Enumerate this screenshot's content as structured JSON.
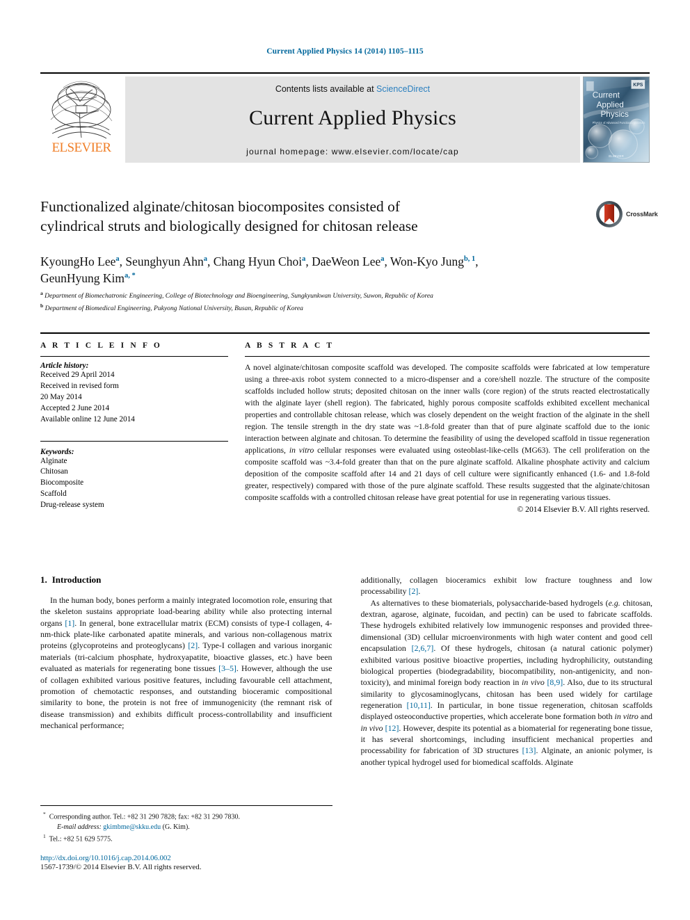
{
  "running_head": "Current Applied Physics 14 (2014) 1105–1115",
  "masthead": {
    "publisher": "ELSEVIER",
    "contents_prefix": "Contents lists available at ",
    "contents_link": "ScienceDirect",
    "journal_title": "Current Applied Physics",
    "homepage": "journal homepage: www.elsevier.com/locate/cap",
    "cover_line1": "Current",
    "cover_line2": "Applied",
    "cover_line3": "Physics",
    "cover_sub": "Physics of Advanced Functional Materials & Devices",
    "cover_badge": "KPS"
  },
  "title": {
    "line1": "Functionalized alginate/chitosan biocomposites consisted of",
    "line2": "cylindrical struts and biologically designed for chitosan release",
    "crossmark_label": "CrossMark"
  },
  "authors": {
    "list": [
      {
        "name": "KyoungHo Lee",
        "sup": "a"
      },
      {
        "name": "Seunghyun Ahn",
        "sup": "a"
      },
      {
        "name": "Chang Hyun Choi",
        "sup": "a"
      },
      {
        "name": "DaeWeon Lee",
        "sup": "a"
      },
      {
        "name": "Won-Kyo Jung",
        "sup": "b, 1"
      },
      {
        "name": "GeunHyung Kim",
        "sup": "a, *"
      }
    ],
    "affiliations": [
      {
        "marker": "a",
        "text": "Department of Biomechatronic Engineering, College of Biotechnology and Bioengineering, Sungkyunkwan University, Suwon, Republic of Korea"
      },
      {
        "marker": "b",
        "text": "Department of Biomedical Engineering, Pukyong National University, Busan, Republic of Korea"
      }
    ]
  },
  "article_info": {
    "heading": "A R T I C L E  I N F O",
    "history_label": "Article history:",
    "history": [
      "Received 29 April 2014",
      "Received in revised form",
      "20 May 2014",
      "Accepted 2 June 2014",
      "Available online 12 June 2014"
    ],
    "keywords_label": "Keywords:",
    "keywords": [
      "Alginate",
      "Chitosan",
      "Biocomposite",
      "Scaffold",
      "Drug-release system"
    ]
  },
  "abstract": {
    "heading": "A B S T R A C T",
    "text_part1": "A novel alginate/chitosan composite scaffold was developed. The composite scaffolds were fabricated at low temperature using a three-axis robot system connected to a micro-dispenser and a core/shell nozzle. The structure of the composite scaffolds included hollow struts; deposited chitosan on the inner walls (core region) of the struts reacted electrostatically with the alginate layer (shell region). The fabricated, highly porous composite scaffolds exhibited excellent mechanical properties and controllable chitosan release, which was closely dependent on the weight fraction of the alginate in the shell region. The tensile strength in the dry state was ~1.8-fold greater than that of pure alginate scaffold due to the ionic interaction between alginate and chitosan. To determine the feasibility of using the developed scaffold in tissue regeneration applications, ",
    "italic1": "in vitro",
    "text_part2": " cellular responses were evaluated using osteoblast-like-cells (MG63). The cell proliferation on the composite scaffold was ~3.4-fold greater than that on the pure alginate scaffold. Alkaline phosphate activity and calcium deposition of the composite scaffold after 14 and 21 days of cell culture were significantly enhanced (1.6- and 1.8-fold greater, respectively) compared with those of the pure alginate scaffold. These results suggested that the alginate/chitosan composite scaffolds with a controlled chitosan release have great potential for use in regenerating various tissues.",
    "copyright": "© 2014 Elsevier B.V. All rights reserved."
  },
  "introduction": {
    "number": "1.",
    "heading": "Introduction",
    "left_p1_a": "In the human body, bones perform a mainly integrated locomotion role, ensuring that the skeleton sustains appropriate load-bearing ability while also protecting internal organs ",
    "ref1": "[1]",
    "left_p1_b": ". In general, bone extracellular matrix (ECM) consists of type-I collagen, 4-nm-thick plate-like carbonated apatite minerals, and various non-collagenous matrix proteins (glycoproteins and proteoglycans) ",
    "ref2": "[2]",
    "left_p1_c": ". Type-I collagen and various inorganic materials (tri-calcium phosphate, hydroxyapatite, bioactive glasses, etc.) have been evaluated as materials for regenerating bone tissues ",
    "ref3": "[3–5]",
    "left_p1_d": ". However, although the use of collagen exhibited various positive features, including favourable cell attachment, promotion of chemotactic responses, and outstanding bioceramic compositional similarity to bone, the protein is not free of immunogenicity (the remnant risk of disease transmission) and exhibits difficult process-controllability and insufficient mechanical performance;",
    "right_p1_a": "additionally, collagen bioceramics exhibit low fracture toughness and low processability ",
    "ref4": "[2]",
    "right_p1_b": ".",
    "right_p2_a": "As alternatives to these biomaterials, polysaccharide-based hydrogels (",
    "eg": "e.g.",
    "right_p2_b": " chitosan, dextran, agarose, alginate, fucoidan, and pectin) can be used to fabricate scaffolds. These hydrogels exhibited relatively low immunogenic responses and provided three-dimensional (3D) cellular microenvironments with high water content and good cell encapsulation ",
    "ref5": "[2,6,7]",
    "right_p2_c": ". Of these hydrogels, chitosan (a natural cationic polymer) exhibited various positive bioactive properties, including hydrophilicity, outstanding biological properties (biodegradability, biocompatibility, non-antigenicity, and non-toxicity), and minimal foreign body reaction in ",
    "invivo1": "in vivo",
    "right_p2_d": " ",
    "ref6": "[8,9]",
    "right_p2_e": ". Also, due to its structural similarity to glycosaminoglycans, chitosan has been used widely for cartilage regeneration ",
    "ref7": "[10,11]",
    "right_p2_f": ". In particular, in bone tissue regeneration, chitosan scaffolds displayed osteoconductive properties, which accelerate bone formation both ",
    "invitro2": "in vitro",
    "right_p2_g": " and ",
    "invivo2": "in vivo",
    "right_p2_h": " ",
    "ref8": "[12]",
    "right_p2_i": ". However, despite its potential as a biomaterial for regenerating bone tissue, it has several shortcomings, including insufficient mechanical properties and processability for fabrication of 3D structures ",
    "ref9": "[13]",
    "right_p2_j": ". Alginate, an anionic polymer, is another typical hydrogel used for biomedical scaffolds. Alginate"
  },
  "footnotes": {
    "corresponding": "Corresponding author. Tel.: +82 31 290 7828; fax: +82 31 290 7830.",
    "email_label": "E-mail address:",
    "email": "gkimbme@skku.edu",
    "email_owner": "(G. Kim).",
    "note1_marker": "1",
    "note1": "Tel.: +82 51 629 5775.",
    "doi": "http://dx.doi.org/10.1016/j.cap.2014.06.002",
    "issn": "1567-1739/© 2014 Elsevier B.V. All rights reserved."
  },
  "colors": {
    "link": "#00679c",
    "elsevier_orange": "#f07e26",
    "masthead_gray": "#e3e3e3"
  }
}
